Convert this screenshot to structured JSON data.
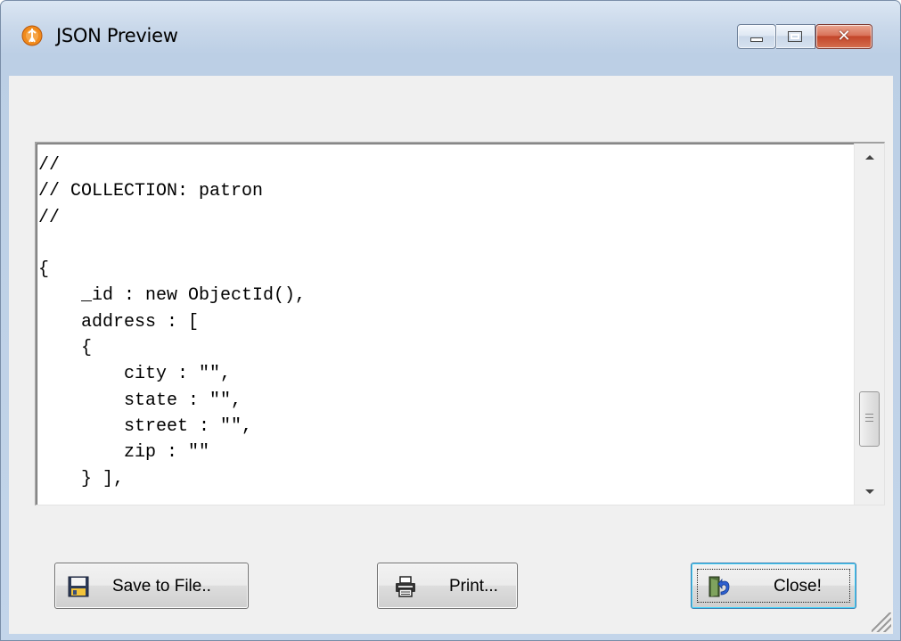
{
  "window": {
    "title": "JSON Preview",
    "icon": "app-logo-icon"
  },
  "titlebar_buttons": {
    "minimize_icon": "minimize-icon",
    "maximize_icon": "maximize-icon",
    "close_icon": "close-icon",
    "close_glyph": "✕"
  },
  "preview": {
    "lines": [
      "//",
      "// COLLECTION: patron",
      "//",
      "",
      "{",
      "    _id : new ObjectId(),",
      "    address : [",
      "    {",
      "        city : \"\",",
      "        state : \"\",",
      "        street : \"\",",
      "        zip : \"\"",
      "    } ],"
    ]
  },
  "buttons": {
    "save_label": "Save to File..",
    "save_icon": "floppy-disk-icon",
    "print_label": "Print...",
    "print_icon": "printer-icon",
    "close_label": "Close!",
    "close_icon": "exit-door-icon"
  },
  "colors": {
    "client_background": "#f0f0f0",
    "close_button": "#c3462a",
    "focus_border": "#3c7fb1"
  }
}
